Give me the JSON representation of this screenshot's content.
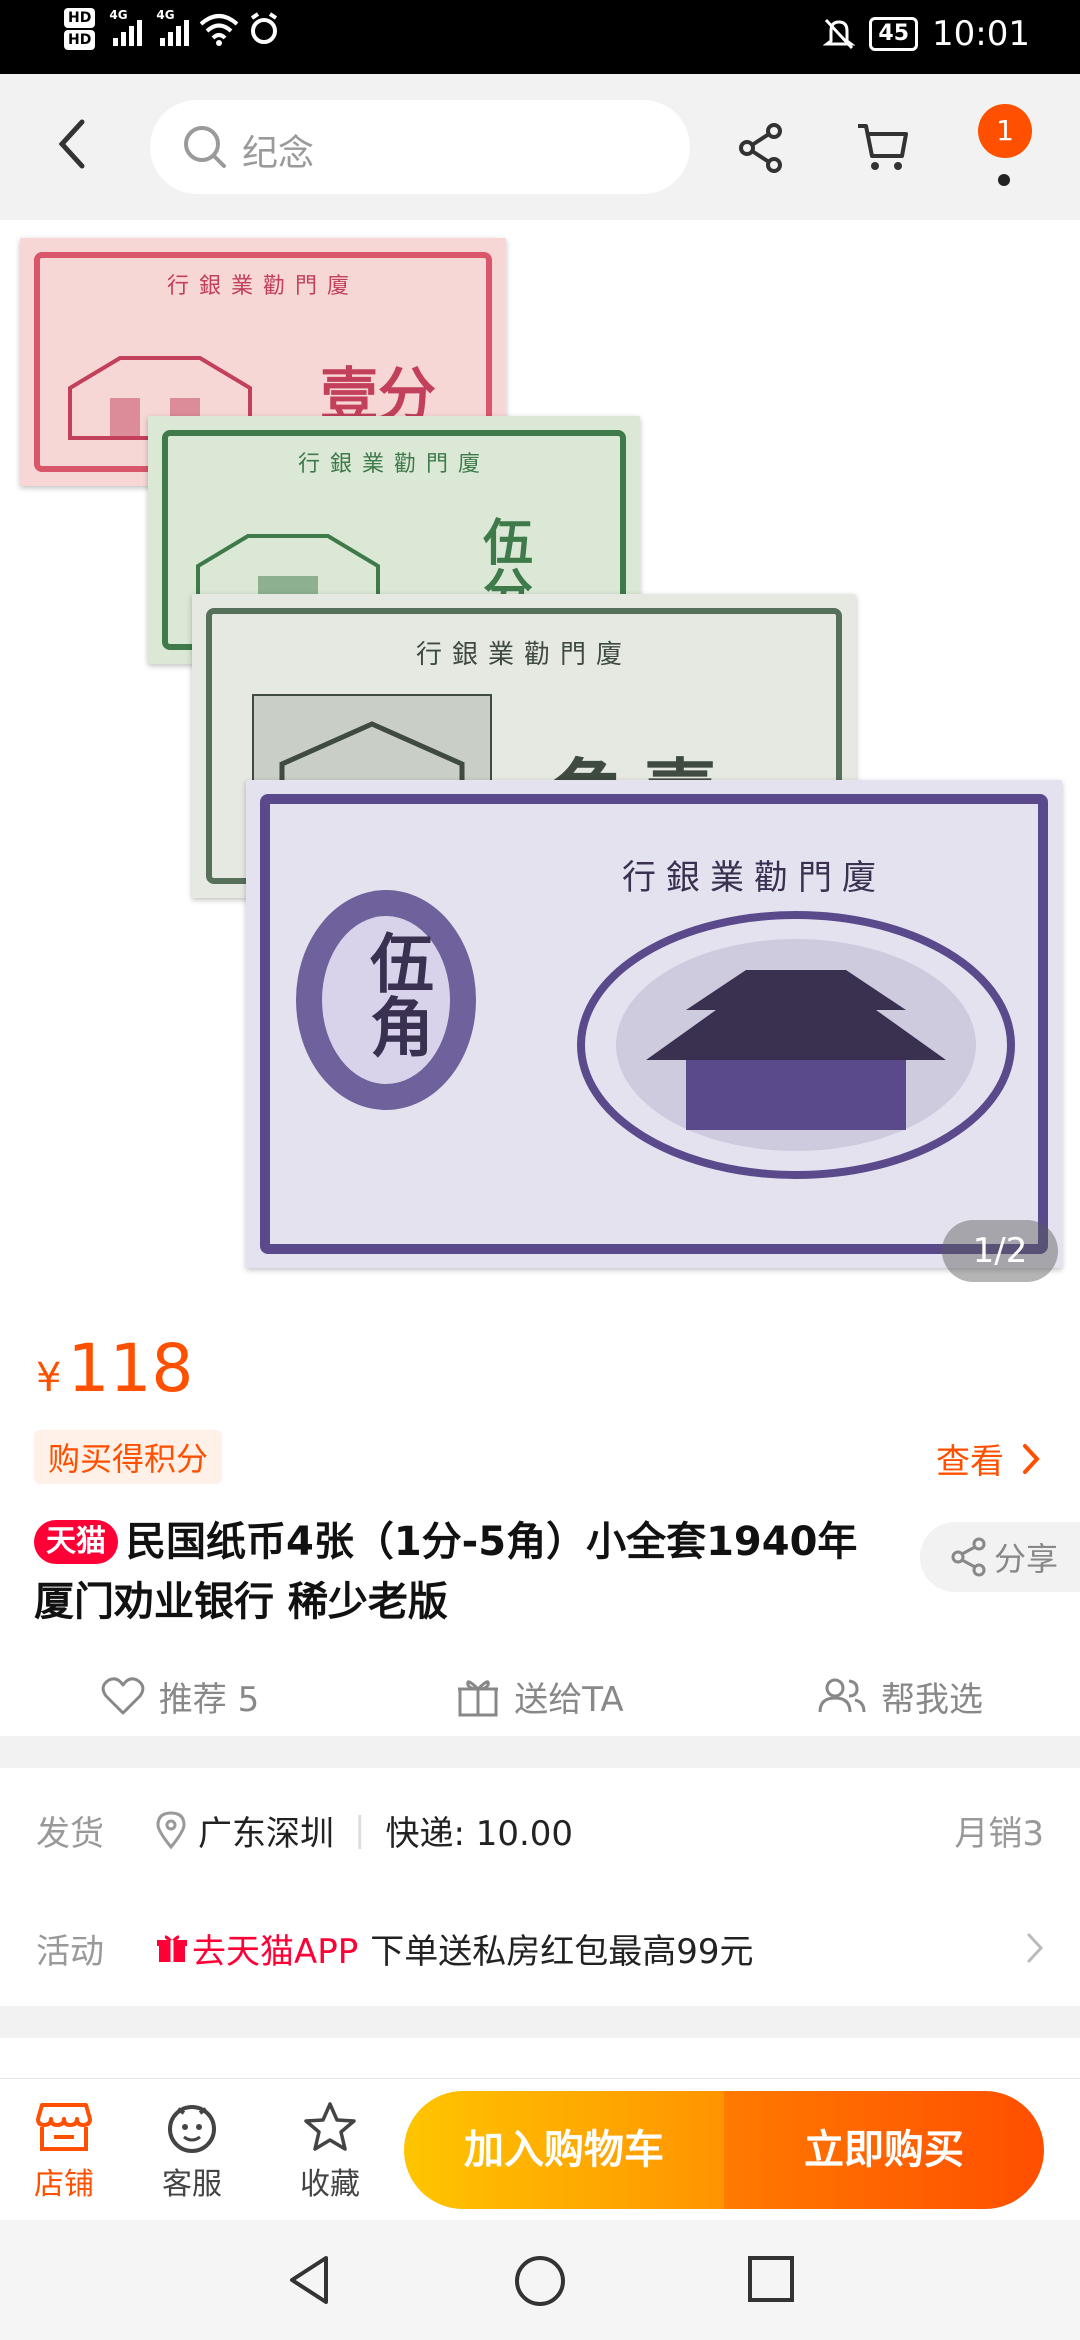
{
  "status_bar": {
    "hd1": "HD",
    "hd2": "HD",
    "network1": "4G",
    "network2": "4G",
    "battery": "45",
    "time": "10:01",
    "icons": [
      "signal-icon",
      "wifi-icon",
      "alarm-icon",
      "mute-icon",
      "battery-icon"
    ]
  },
  "header": {
    "search_placeholder": "纪念",
    "badge_count": "1",
    "icons": [
      "back-icon",
      "search-icon",
      "share-icon",
      "cart-icon",
      "more-icon"
    ]
  },
  "gallery": {
    "page_indicator": "1/2",
    "notes": [
      {
        "bank": "行銀業勸門廈",
        "denom": "壹分",
        "color": "#d9566b"
      },
      {
        "bank": "行銀業勸門廈",
        "denom": "伍分",
        "color": "#3f7a4a"
      },
      {
        "bank": "行銀業勸門廈",
        "denom": "角壹",
        "color": "#56705a"
      },
      {
        "bank": "行銀業勸門廈",
        "denom": "伍角",
        "color": "#5a4a8c"
      }
    ]
  },
  "product": {
    "currency": "¥",
    "price": "118",
    "points_tag": "购买得积分",
    "view_label": "查看",
    "store_tag": "天猫",
    "title": "民国纸币4张（1分-5角）小全套1940年 厦门劝业银行 稀少老版",
    "share_label": "分享",
    "actions": {
      "recommend": "推荐 5",
      "gift": "送给TA",
      "help": "帮我选"
    }
  },
  "delivery": {
    "ship_label": "发货",
    "location": "广东深圳",
    "sep": "|",
    "express": "快递: 10.00",
    "monthly": "月销3",
    "activity_label": "活动",
    "promo_tag": "去天猫APP",
    "promo_text": "下单送私房红包最高99元"
  },
  "bottom_bar": {
    "store": "店铺",
    "service": "客服",
    "favorite": "收藏",
    "add_cart": "加入购物车",
    "buy_now": "立即购买"
  },
  "colors": {
    "accent": "#ff5000",
    "tmall_red": "#ff0036",
    "cart_yellow": "#ffc500",
    "buy_orange": "#ff4e00"
  }
}
